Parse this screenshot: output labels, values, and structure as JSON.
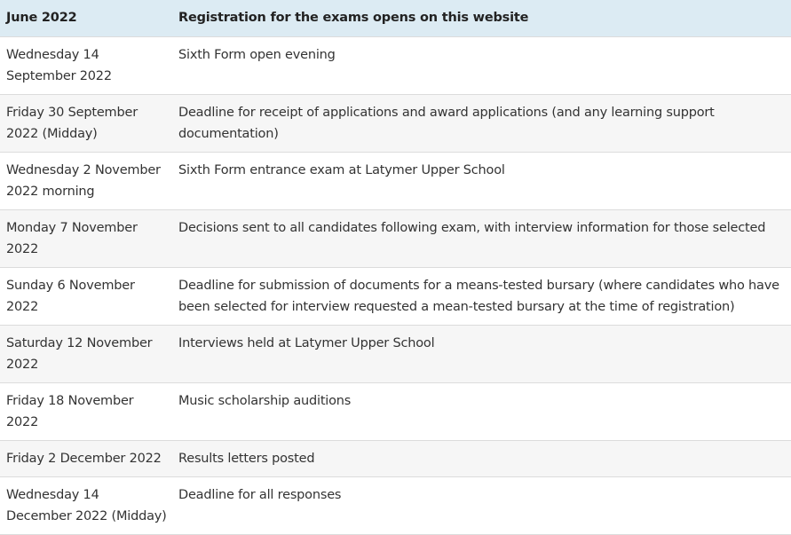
{
  "header": {
    "date": "June 2022",
    "event": "Registration for the exams opens on this website"
  },
  "rows": [
    {
      "date": "Wednesday 14 September 2022",
      "event": "Sixth Form open evening"
    },
    {
      "date": "Friday 30 September 2022 (Midday)",
      "event": "Deadline for receipt of applications and award applications (and any learning support documentation)"
    },
    {
      "date": "Wednesday 2 November 2022 morning",
      "event": "Sixth Form entrance exam at Latymer Upper School"
    },
    {
      "date": "Monday 7 November 2022",
      "event": "Decisions sent to all candidates following exam, with interview information for those selected"
    },
    {
      "date": "Sunday 6 November 2022",
      "event": "Deadline for submission of documents for a means-tested bursary (where candidates who have been selected for interview requested a mean-tested bursary at the time of registration)"
    },
    {
      "date": "Saturday 12 November 2022",
      "event": "Interviews held at Latymer Upper School"
    },
    {
      "date": "Friday 18 November 2022",
      "event": "Music scholarship auditions"
    },
    {
      "date": "Friday 2 December 2022",
      "event": "Results letters posted"
    },
    {
      "date": "Wednesday 14 December 2022 (Midday)",
      "event": "Deadline for all responses"
    }
  ]
}
